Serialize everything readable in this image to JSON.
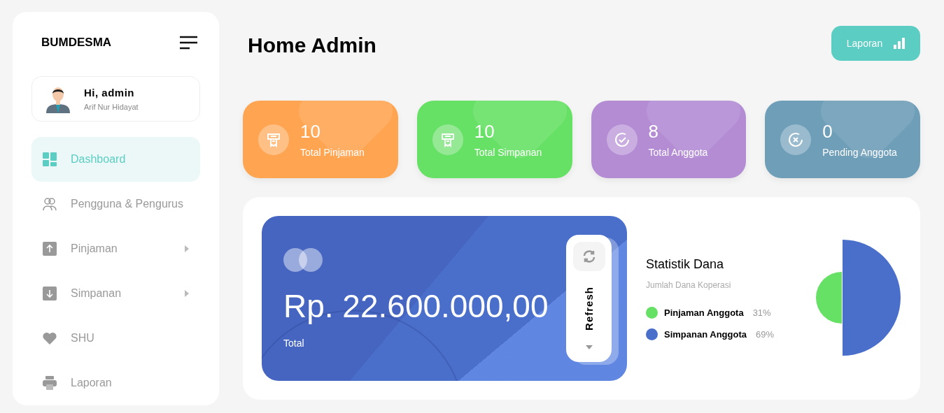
{
  "sidebar": {
    "brand": "BUMDESMA",
    "user": {
      "greeting": "Hi, admin",
      "name": "Arif Nur Hidayat"
    },
    "items": [
      {
        "label": "Dashboard",
        "selected": true,
        "submenu": false
      },
      {
        "label": "Pengguna & Pengurus",
        "selected": false,
        "submenu": false
      },
      {
        "label": "Pinjaman",
        "selected": false,
        "submenu": true
      },
      {
        "label": "Simpanan",
        "selected": false,
        "submenu": true
      },
      {
        "label": "SHU",
        "selected": false,
        "submenu": false
      },
      {
        "label": "Laporan",
        "selected": false,
        "submenu": false
      }
    ]
  },
  "header": {
    "title": "Home Admin",
    "button": "Laporan"
  },
  "stats": [
    {
      "value": "10",
      "label": "Total Pinjaman",
      "color": "#ffa552"
    },
    {
      "value": "10",
      "label": "Total Simpanan",
      "color": "#67e066"
    },
    {
      "value": "8",
      "label": "Total Anggota",
      "color": "#b38cd4"
    },
    {
      "value": "0",
      "label": "Pending Anggota",
      "color": "#6e9eb8"
    }
  ],
  "balance": {
    "amount": "Rp. 22.600.000,00",
    "caption": "Total",
    "refresh": "Refresh"
  },
  "statistics": {
    "title": "Statistik Dana",
    "subtitle": "Jumlah Dana Koperasi",
    "legend": [
      {
        "label": "Pinjaman Anggota",
        "percent": "31%",
        "color": "#67e066"
      },
      {
        "label": "Simpanan Anggota",
        "percent": "69%",
        "color": "#4a6fcb"
      }
    ]
  }
}
